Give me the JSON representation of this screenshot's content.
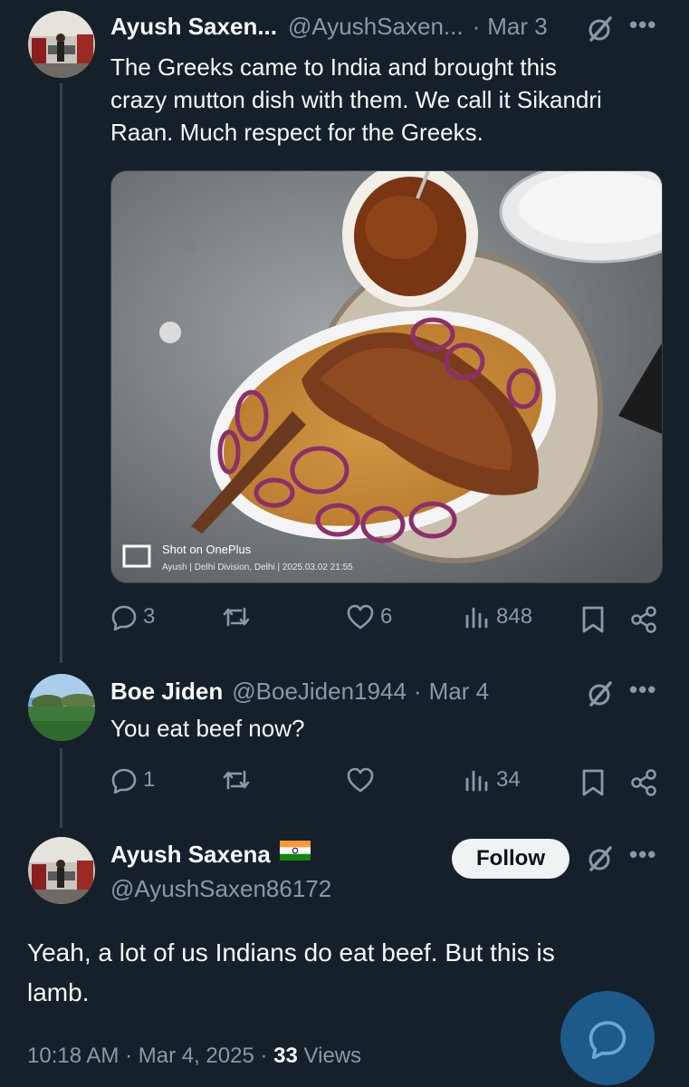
{
  "tweet1": {
    "display_name": "Ayush Saxen...",
    "handle": "@AyushSaxen...",
    "dot": "·",
    "date": "Mar 3",
    "text_lines": [
      "The Greeks came to India and brought this",
      "crazy mutton dish with them. We call it Sikandri",
      "Raan. Much respect for the Greeks."
    ],
    "image": {
      "watermark_title": "Shot on OnePlus",
      "watermark_detail": "Ayush | Delhi Division, Delhi | 2025.03.02 21:55"
    },
    "replies": "3",
    "reposts": "",
    "likes": "6",
    "views": "848"
  },
  "tweet2": {
    "display_name": "Boe Jiden",
    "handle": "@BoeJiden1944",
    "dot": "·",
    "date": "Mar 4",
    "text": "You eat beef now?",
    "replies": "1",
    "reposts": "",
    "likes": "",
    "views": "34"
  },
  "tweet3": {
    "display_name": "Ayush Saxena",
    "handle": "@AyushSaxen86172",
    "follow_label": "Follow",
    "text_lines": [
      "Yeah, a lot of us Indians do eat beef. But this is",
      "lamb."
    ],
    "time": "10:18 AM",
    "date": "Mar 4, 2025",
    "dot": "·",
    "views_count": "33",
    "views_label": "Views"
  },
  "colors": {
    "background": "#15202b",
    "text": "#f7f9f9",
    "muted": "#8b98a5",
    "follow_bg": "#eff3f4",
    "fab": "#1d5a8a"
  },
  "icons": [
    "reply-icon",
    "repost-icon",
    "like-icon",
    "views-icon",
    "bookmark-icon",
    "share-icon",
    "grok-icon",
    "more-icon",
    "compose-reply-icon"
  ]
}
